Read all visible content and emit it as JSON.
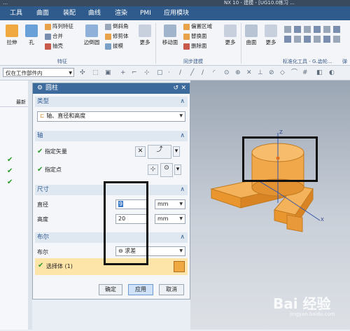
{
  "app": {
    "title_left": "…",
    "title_center": "NX 10 - 建模 - [UG10.0练习 ...",
    "window_controls": [
      "−",
      "□",
      "×"
    ]
  },
  "menu": {
    "items": [
      "工具",
      "曲面",
      "装配",
      "曲线",
      "渲染",
      "PMI",
      "应用模块"
    ]
  },
  "ribbon": {
    "big_buttons": [
      "拉伸",
      "孔",
      "边倒圆",
      "更多",
      "移动面",
      "更多",
      "曲面",
      "更多"
    ],
    "small_buttons": [
      "阵列特征",
      "合并",
      "抽壳",
      "倒斜角",
      "修剪体",
      "拔模",
      "偏置区域",
      "替换面",
      "删除面"
    ],
    "groups": [
      "特征",
      "同步建模",
      "标准化工具 - G...",
      "齿轮...",
      "弹"
    ]
  },
  "toolbar": {
    "filter_value": "仅在工作部件内"
  },
  "left_panel": {
    "header": "最新",
    "check_mark": "✔"
  },
  "dialog": {
    "title": "圆柱",
    "sections": {
      "type": {
        "label": "类型",
        "value": "轴、直径和高度"
      },
      "axis": {
        "label": "轴",
        "specify_vector": "指定矢量",
        "specify_point": "指定点"
      },
      "dimensions": {
        "label": "尺寸",
        "diameter_label": "直径",
        "diameter_value": "9",
        "diameter_unit": "mm",
        "height_label": "高度",
        "height_value": "20",
        "height_unit": "mm"
      },
      "boolean": {
        "label": "布尔",
        "bool_label": "布尔",
        "bool_value": "求差",
        "select_body": "选择体 (1)"
      }
    },
    "buttons": {
      "ok": "确定",
      "apply": "应用",
      "cancel": "取消"
    }
  },
  "viewport": {
    "axis_labels": {
      "z": "Z",
      "x": "X"
    }
  },
  "watermark": {
    "text": "Bai 经验",
    "sub": "jingyan.baidu.com"
  },
  "colors": {
    "menu_bg": "#2f5b8c",
    "dialog_header": "#3c6a9c",
    "section_text": "#2f5c92",
    "model_orange": "#f1a84a",
    "check_green": "#2a9a2a"
  }
}
